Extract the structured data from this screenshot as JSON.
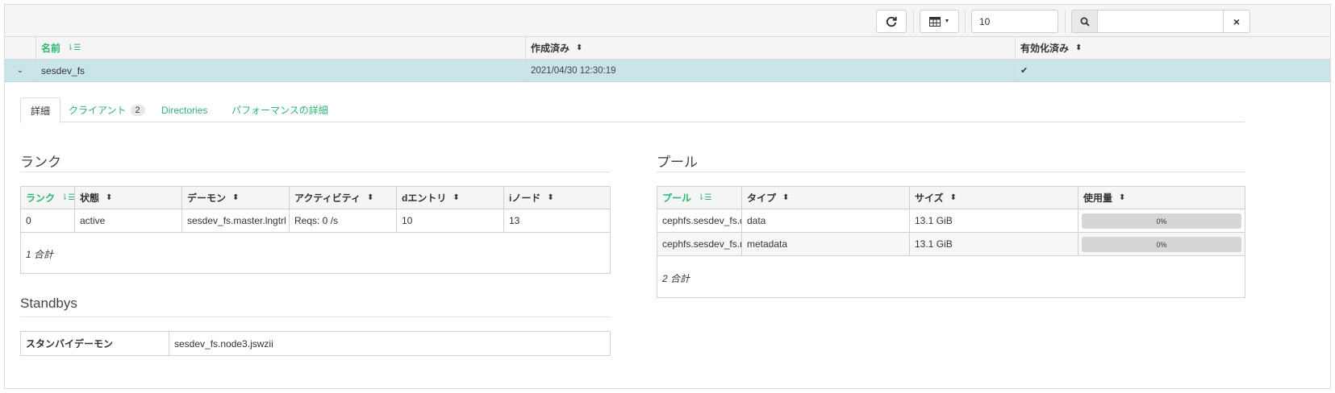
{
  "toolbar": {
    "refresh_icon": "refresh-icon",
    "columns_icon": "table-columns-icon",
    "page_size": "10",
    "search_value": "",
    "clear_label": "×"
  },
  "main_table": {
    "columns": [
      "名前",
      "作成済み",
      "有効化済み"
    ],
    "rows": [
      {
        "name": "sesdev_fs",
        "created": "2021/04/30 12:30:19",
        "enabled": "✔"
      }
    ]
  },
  "detail": {
    "tabs": [
      {
        "label": "詳細",
        "active": true
      },
      {
        "label": "クライアント",
        "badge": "2"
      },
      {
        "label": "Directories"
      },
      {
        "label": "パフォーマンスの詳細"
      }
    ],
    "ranks": {
      "title": "ランク",
      "columns": [
        "ランク",
        "状態",
        "デーモン",
        "アクティビティ",
        "dエントリ",
        "iノード"
      ],
      "rows": [
        [
          "0",
          "active",
          "sesdev_fs.master.lngtrl",
          "Reqs: 0 /s",
          "10",
          "13"
        ]
      ],
      "footer": "1 合計"
    },
    "standbys": {
      "title": "Standbys",
      "label": "スタンバイデーモン",
      "value": "sesdev_fs.node3.jswzii"
    },
    "pools": {
      "title": "プール",
      "columns": [
        "プール",
        "タイプ",
        "サイズ",
        "使用量"
      ],
      "rows": [
        {
          "pool": "cephfs.sesdev_fs.data",
          "type": "data",
          "size": "13.1 GiB",
          "usage": "0%"
        },
        {
          "pool": "cephfs.sesdev_fs.meta",
          "type": "metadata",
          "size": "13.1 GiB",
          "usage": "0%"
        }
      ],
      "footer": "2 合計"
    }
  },
  "colors": {
    "accent": "#2bb673",
    "selected_row": "#c9e5ea"
  }
}
